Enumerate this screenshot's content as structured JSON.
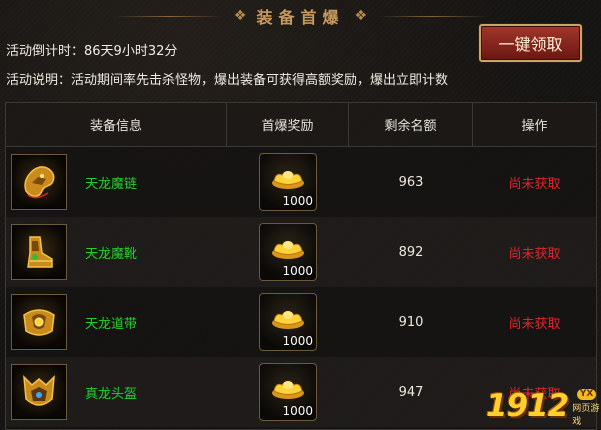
{
  "header": {
    "title": "装备首爆",
    "countdown": "活动倒计时：86天9小时32分",
    "description": "活动说明：活动期间率先击杀怪物，爆出装备可获得高额奖励，爆出立即计数",
    "claim_all_label": "一键领取"
  },
  "table": {
    "columns": [
      "装备信息",
      "首爆奖励",
      "剩余名额",
      "操作"
    ],
    "rows": [
      {
        "name": "天龙魔链",
        "icon": "dragon-necklace-icon",
        "reward": "1000",
        "remaining": "963",
        "status": "尚未获取"
      },
      {
        "name": "天龙魔靴",
        "icon": "dragon-boots-icon",
        "reward": "1000",
        "remaining": "892",
        "status": "尚未获取"
      },
      {
        "name": "天龙道带",
        "icon": "dragon-belt-icon",
        "reward": "1000",
        "remaining": "910",
        "status": "尚未获取"
      },
      {
        "name": "真龙头盔",
        "icon": "dragon-helmet-icon",
        "reward": "1000",
        "remaining": "947",
        "status": "尚未获取"
      }
    ]
  },
  "watermark": {
    "number": "1912",
    "badge": "YX",
    "subtitle": "网页游戏"
  },
  "colors": {
    "item_name": "#23d12b",
    "status": "#e0242a",
    "title": "#c79a5a",
    "button": "#a2362b"
  }
}
